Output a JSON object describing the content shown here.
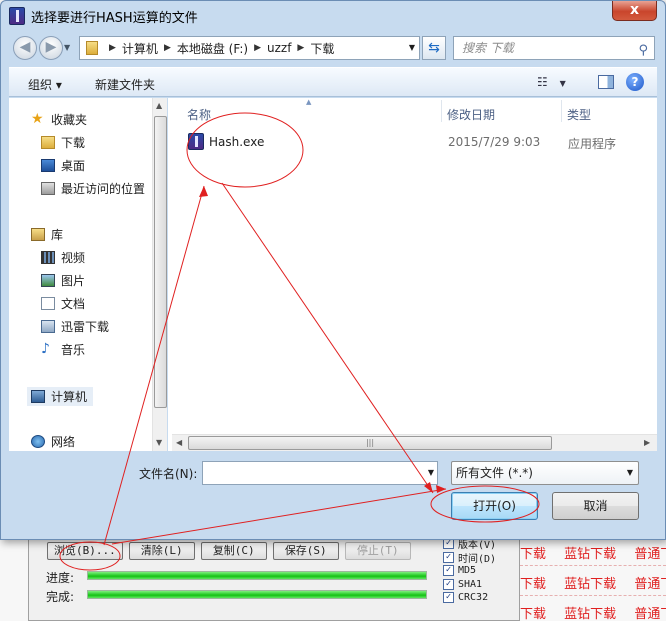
{
  "background": {
    "header_text": "",
    "link_rows": [
      [
        "下载",
        "蓝钻下载",
        "普通下"
      ],
      [
        "下载",
        "蓝钻下载",
        "普通下"
      ],
      [
        "下载",
        "蓝钻下载",
        "普通下"
      ]
    ]
  },
  "hash_app": {
    "buttons": {
      "browse": "浏览(B)...",
      "clear": "清除(L)",
      "copy": "复制(C)",
      "save": "保存(S)",
      "stop": "停止(T)"
    },
    "progress_label": "进度:",
    "complete_label": "完成:",
    "progress_value": 1.0,
    "complete_value": 1.0,
    "options": [
      {
        "label": "版本(V)",
        "checked": true
      },
      {
        "label": "时间(D)",
        "checked": true
      },
      {
        "label": "MD5",
        "checked": true
      },
      {
        "label": "SHA1",
        "checked": true
      },
      {
        "label": "CRC32",
        "checked": true
      }
    ]
  },
  "dialog": {
    "title": "选择要进行HASH运算的文件",
    "close_glyph": "x",
    "address": {
      "crumbs": [
        "计算机",
        "本地磁盘 (F:)",
        "uzzf",
        "下载"
      ]
    },
    "search_placeholder": "搜索 下载",
    "toolbar": {
      "organize": "组织 ▾",
      "new_folder": "新建文件夹"
    },
    "nav": {
      "favorites": "收藏夹",
      "downloads": "下载",
      "desktop": "桌面",
      "recent": "最近访问的位置",
      "libraries": "库",
      "videos": "视频",
      "pictures": "图片",
      "documents": "文档",
      "thunder": "迅雷下载",
      "music": "音乐",
      "computer": "计算机",
      "network": "网络"
    },
    "columns": {
      "name": "名称",
      "date": "修改日期",
      "type": "类型"
    },
    "files": [
      {
        "name": "Hash.exe",
        "date": "2015/7/29 9:03",
        "type": "应用程序"
      }
    ],
    "filename_label": "文件名(N):",
    "filename_value": "",
    "filter_value": "所有文件 (*.*)",
    "open_button": "打开(O)",
    "cancel_button": "取消"
  },
  "colors": {
    "annotation": "#e02020",
    "accent": "#3c7fb1"
  }
}
